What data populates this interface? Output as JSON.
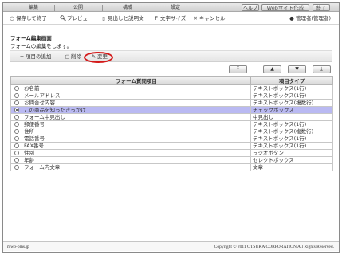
{
  "topbar": {
    "tabs": [
      "編集",
      "公開",
      "構成",
      "設定"
    ],
    "help_label": "ヘルプ",
    "web_label": "Webサイト作成",
    "quit_label": "終了"
  },
  "toolbar": {
    "save_label": "保存して終了",
    "preview_label": "プレビュー",
    "desc_label": "見出しと説明文",
    "fontsize_label": "文字サイズ",
    "cancel_label": "キャンセル",
    "admin_label": "管理者(管理者)"
  },
  "page": {
    "title": "フォーム編集画面",
    "subtitle": "フォームの編集をします。"
  },
  "actions": {
    "add_label": "項目の追加",
    "delete_label": "削除",
    "edit_label": "変更"
  },
  "table": {
    "headers": [
      "",
      "フォーム質問項目",
      "項目タイプ"
    ],
    "rows": [
      {
        "name": "お名前",
        "type": "テキストボックス(1行)"
      },
      {
        "name": "メールアドレス",
        "type": "テキストボックス(1行)"
      },
      {
        "name": "お問合せ内容",
        "type": "テキストボックス(複数行)"
      },
      {
        "name": "この商品を知ったきっかけ",
        "type": "チェックボックス"
      },
      {
        "name": "フォーム中見出し",
        "type": "中見出し"
      },
      {
        "name": "郵便番号",
        "type": "テキストボックス(1行)"
      },
      {
        "name": "住所",
        "type": "テキストボックス(複数行)"
      },
      {
        "name": "電話番号",
        "type": "テキストボックス(1行)"
      },
      {
        "name": "FAX番号",
        "type": "テキストボックス(1行)"
      },
      {
        "name": "性別",
        "type": "ラジオボタン"
      },
      {
        "name": "年齢",
        "type": "セレクトボックス"
      },
      {
        "name": "フォーム内文章",
        "type": "文章"
      }
    ],
    "selected_index": 3
  },
  "footer": {
    "link": "mwb-pms.jp",
    "copyright": "Copyright © 2011 OTSUKA CORPORATION All Rights Reserved."
  },
  "colors": {
    "selected_row": "#b9b9f2",
    "highlight_circle": "#d41a1a"
  }
}
